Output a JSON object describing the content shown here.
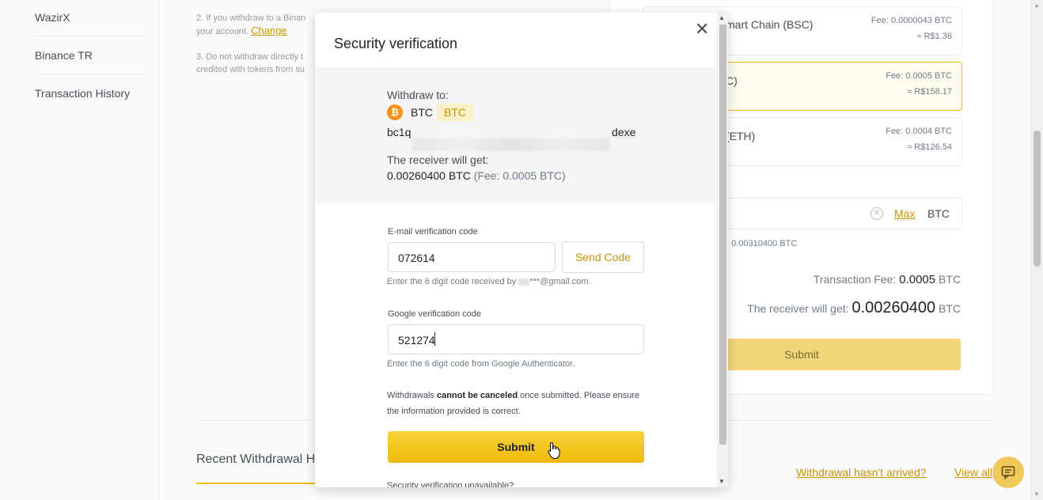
{
  "sidebar": {
    "items": [
      {
        "label": "WazirX"
      },
      {
        "label": "Binance TR"
      },
      {
        "label": "Transaction History"
      }
    ]
  },
  "tips": {
    "tip2_line1": "2. If you withdraw to a Binan",
    "tip2_line2": "your account.",
    "tip2_link": "Change",
    "tip3_line1": "3. Do not withdraw directly t",
    "tip3_line2": "credited with tokens from su"
  },
  "networks": [
    {
      "name": "mart Chain (BSC)",
      "sub": ")",
      "fee": "Fee: 0.0000043 BTC",
      "approx": "≈ R$1.36"
    },
    {
      "name": "C)",
      "fee": "Fee: 0.0005 BTC",
      "approx": "≈ R$158.17"
    },
    {
      "name": "(ETH)",
      "fee": "Fee: 0.0004 BTC",
      "approx": "≈ R$126.54"
    }
  ],
  "amount": {
    "max_label": "Max",
    "unit": "BTC",
    "available": ": 0.00310400 BTC"
  },
  "summary": {
    "fee_label": "Transaction Fee:",
    "fee_value": "0.0005",
    "fee_unit": "BTC",
    "receive_label": "The receiver will get:",
    "receive_value": "0.00260400",
    "receive_unit": "BTC",
    "submit_label": "Submit"
  },
  "history": {
    "title": "Recent Withdrawal H",
    "not_arrived": "Withdrawal hasn't arrived?",
    "view_all": "View all"
  },
  "modal": {
    "title": "Security verification",
    "withdraw_to_label": "Withdraw to:",
    "coin": "BTC",
    "coin_badge": "BTC",
    "address_prefix": "bc1q",
    "address_suffix": "dexe",
    "receiver_label": "The receiver will get:",
    "receiver_amount": "0.00260400 BTC",
    "receiver_fee": "(Fee: 0.0005 BTC)",
    "email_label": "E-mail verification code",
    "email_value": "072614",
    "send_code": "Send Code",
    "email_hint_prefix": "Enter the 6 digit code received by",
    "email_hint_suffix": "***@gmail.com.",
    "google_label": "Google verification code",
    "google_value": "521274",
    "google_hint": "Enter the 6 digit code from Google Authenticator.",
    "warn_prefix": "Withdrawals",
    "warn_bold": "cannot be canceled",
    "warn_suffix": "once submitted. Please ensure the information provided is correct.",
    "submit_label": "Submit",
    "footer_text": "Security verification unavailable?"
  },
  "colors": {
    "accent": "#f0b90b",
    "link": "#c99400",
    "btc": "#f7931a"
  }
}
